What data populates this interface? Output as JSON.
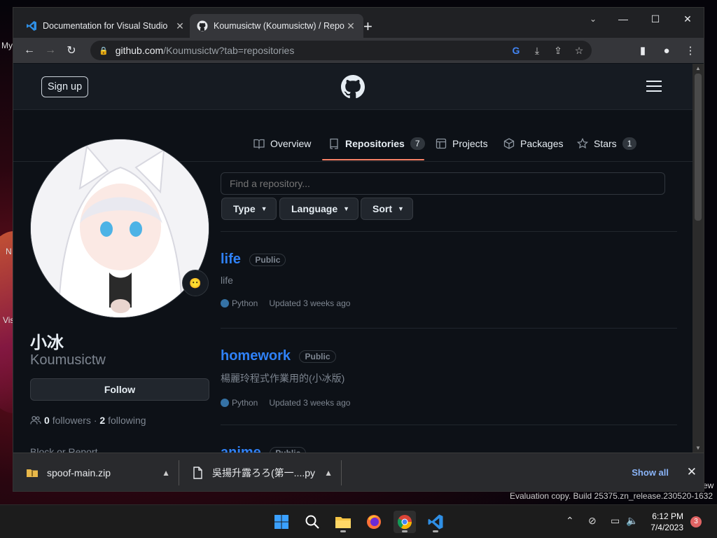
{
  "desktop": {
    "labels": [
      "My",
      "N",
      "Vis",
      "ew"
    ]
  },
  "browser": {
    "tabs": [
      {
        "title": "Documentation for Visual Studio",
        "icon": "vscode-icon",
        "active": false
      },
      {
        "title": "Koumusictw (Koumusictw) / Repo",
        "icon": "github-icon",
        "active": true
      }
    ],
    "new_tab": "+",
    "url_host": "github.com",
    "url_path": "/Koumusictw?tab=repositories"
  },
  "github": {
    "signup_label": "Sign up",
    "nav": [
      {
        "label": "Overview",
        "icon": "book-icon"
      },
      {
        "label": "Repositories",
        "icon": "repo-icon",
        "count": "7"
      },
      {
        "label": "Projects",
        "icon": "table-icon"
      },
      {
        "label": "Packages",
        "icon": "package-icon"
      },
      {
        "label": "Stars",
        "icon": "star-icon",
        "count": "1"
      }
    ],
    "profile": {
      "display_name": "小冰",
      "username": "Koumusictw",
      "follow_label": "Follow",
      "followers_count": "0",
      "followers_label": "followers",
      "separator": "·",
      "following_count": "2",
      "following_label": "following",
      "block_report": "Block or Report",
      "status_emoji": "😶"
    },
    "repo_search_placeholder": "Find a repository...",
    "filters": [
      "Type",
      "Language",
      "Sort"
    ],
    "repos": [
      {
        "name": "life",
        "visibility": "Public",
        "description": "life",
        "language": "Python",
        "updated": "Updated 3 weeks ago"
      },
      {
        "name": "homework",
        "visibility": "Public",
        "description": "楊麗玲程式作業用的(小冰版)",
        "language": "Python",
        "updated": "Updated 3 weeks ago"
      },
      {
        "name": "anime",
        "visibility": "Public"
      }
    ]
  },
  "downloads": {
    "items": [
      "spoof-main.zip",
      "吳揚升露ろろ(第一....py"
    ],
    "show_all": "Show all"
  },
  "watermark": "Evaluation copy. Build 25375.zn_release.230520-1632",
  "taskbar": {
    "time": "6:12 PM",
    "date": "7/4/2023",
    "notification_count": "3"
  },
  "colors": {
    "link": "#2f81f7",
    "accent_underline": "#f78166",
    "python": "#3572A5"
  }
}
